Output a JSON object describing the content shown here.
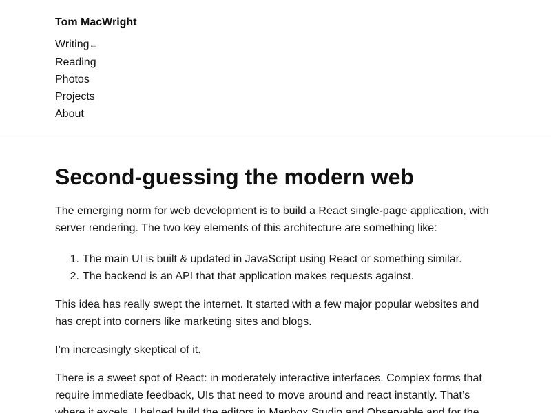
{
  "header": {
    "site_name": "Tom MacWright",
    "nav": [
      {
        "label": "Writing",
        "current_marker": "←·"
      },
      {
        "label": "Reading"
      },
      {
        "label": "Photos"
      },
      {
        "label": "Projects"
      },
      {
        "label": "About"
      }
    ]
  },
  "article": {
    "title": "Second-guessing the modern web",
    "p1": "The emerging norm for web development is to build a React single-page application, with server rendering. The two key elements of this architecture are something like:",
    "list": [
      {
        "num": "1.",
        "text": "The main UI is built & updated in JavaScript using React or something similar."
      },
      {
        "num": "2.",
        "text": "The backend is an API that that application makes requests against."
      }
    ],
    "p2": "This idea has really swept the internet. It started with a few major popular websites and has crept into corners like marketing sites and blogs.",
    "p3": "I’m increasingly skeptical of it.",
    "p4_start": "There is a sweet spot of React: in moderately interactive interfaces. Complex forms that require immediate feedback, UIs that need to move around and react instantly. That’s where it excels. I helped build the editors in ",
    "p4_link1": "Mapbox Studio",
    "p4_mid": " and ",
    "p4_link2": "Observable",
    "p4_end": " and for the"
  }
}
